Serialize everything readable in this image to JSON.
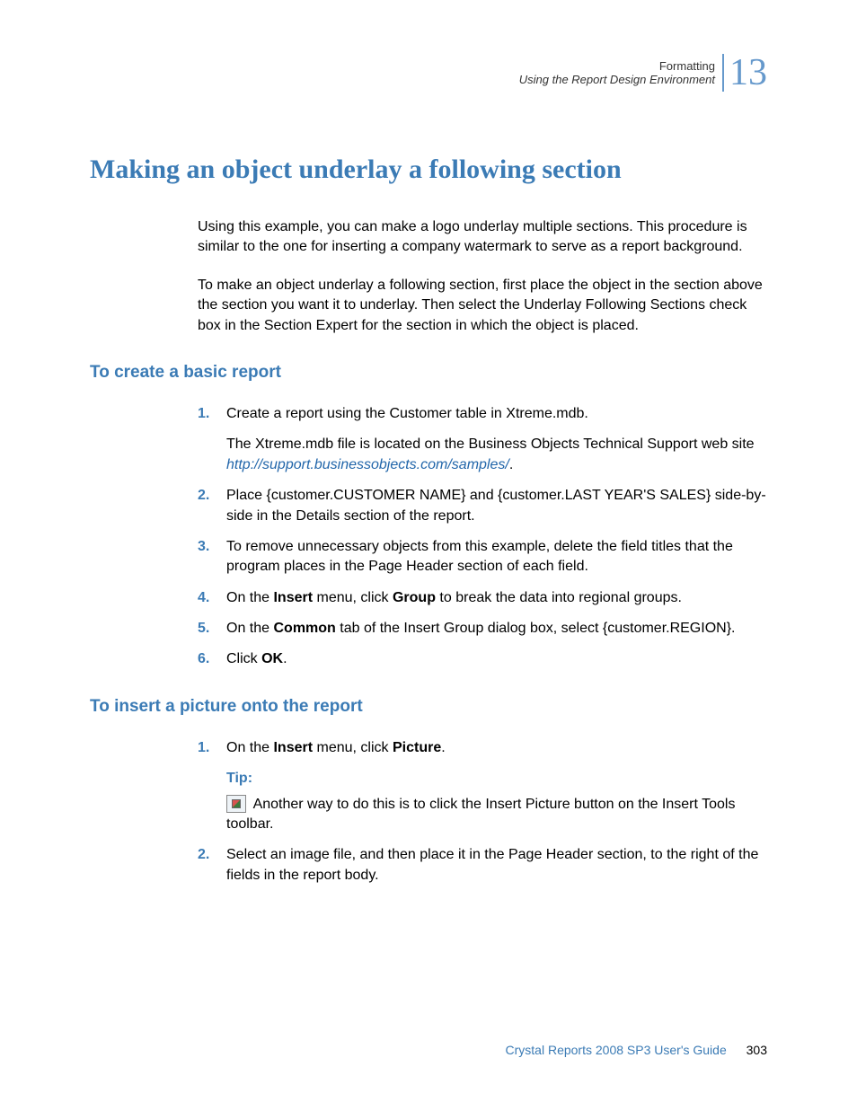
{
  "header": {
    "line1": "Formatting",
    "line2": "Using the Report Design Environment",
    "chapter": "13"
  },
  "title": "Making an object underlay a following section",
  "intro1": "Using this example, you can make a logo underlay multiple sections. This procedure is similar to the one for inserting a company watermark to serve as a report background.",
  "intro2": "To make an object underlay a following section, first place the object in the section above the section you want it to underlay. Then select the Underlay Following Sections check box in the Section Expert for the section in which the object is placed.",
  "section1": {
    "heading": "To create a basic report",
    "steps": {
      "s1": {
        "num": "1.",
        "text": "Create a report using the Customer table in Xtreme.mdb.",
        "sub_prefix": "The Xtreme.mdb file is located on the Business Objects Technical Support web site ",
        "link": "http://support.businessobjects.com/samples/",
        "sub_suffix": "."
      },
      "s2": {
        "num": "2.",
        "text": "Place {customer.CUSTOMER NAME} and {customer.LAST YEAR'S SALES} side-by-side in the Details section of the report."
      },
      "s3": {
        "num": "3.",
        "text": "To remove unnecessary objects from this example, delete the field titles that the program places in the Page Header section of each field."
      },
      "s4": {
        "num": "4.",
        "prefix": "On the ",
        "b1": "Insert",
        "mid": " menu, click ",
        "b2": "Group",
        "suffix": " to break the data into regional groups."
      },
      "s5": {
        "num": "5.",
        "prefix": "On the ",
        "b1": "Common",
        "suffix": " tab of the Insert Group dialog box, select {customer.REGION}."
      },
      "s6": {
        "num": "6.",
        "prefix": "Click ",
        "b1": "OK",
        "suffix": "."
      }
    }
  },
  "section2": {
    "heading": "To insert a picture onto the report",
    "steps": {
      "s1": {
        "num": "1.",
        "prefix": "On the ",
        "b1": "Insert",
        "mid": " menu, click ",
        "b2": "Picture",
        "suffix": ".",
        "tip_label": "Tip:",
        "tip_text": " Another way to do this is to click the Insert Picture button on the Insert Tools toolbar."
      },
      "s2": {
        "num": "2.",
        "text": "Select an image file, and then place it in the Page Header section, to the right of the fields in the report body."
      }
    }
  },
  "footer": {
    "title": "Crystal Reports 2008 SP3 User's Guide",
    "page": "303"
  }
}
